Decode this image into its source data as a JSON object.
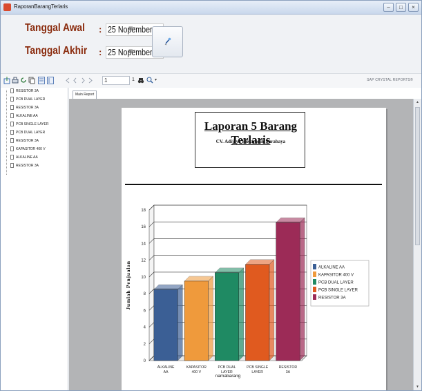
{
  "window": {
    "title": "RaporanBarangTerlaris"
  },
  "params": {
    "start_label": "Tanggal Awal",
    "start_value": "25 Nopember 2015",
    "end_label": "Tanggal Akhir",
    "end_value": "25 Nopember 2015",
    "colon": ":"
  },
  "toolbar": {
    "page_value": "1",
    "page_total": "1",
    "brand": "SAP CRYSTAL REPORTS®"
  },
  "tree": {
    "items": [
      "RESISTOR 3A",
      "PCB DUAL LAYER",
      "RESISTOR 3A",
      "ALKALINE AA",
      "PCB SINGLE LAYER",
      "PCB DUAL LAYER",
      "RESISTOR 3A",
      "KAPASITOR 400 V",
      "ALKALINE AA",
      "RESISTOR 3A"
    ]
  },
  "tabs": {
    "main": "Main Report"
  },
  "report": {
    "title": "Laporan 5 Barang Terlaris",
    "subtitle": "CV. Adijaya Elektronik Surabaya"
  },
  "chart_data": {
    "type": "bar",
    "categories": [
      "ALKALINE AA",
      "KAPASITOR 400 V",
      "PCB DUAL LAYER",
      "PCB SINGLE LAYER",
      "RESISTOR 3A"
    ],
    "values": [
      8.5,
      9.5,
      10.5,
      11.5,
      16.5
    ],
    "colors": [
      "#3b5f95",
      "#ef9a3c",
      "#1f8a63",
      "#e05a1f",
      "#9c2b57"
    ],
    "legend": [
      "ALKALINE AA",
      "KAPASITOR 400 V",
      "PCB DUAL LAYER",
      "PCB SINGLE LAYER",
      "RESISTOR 3A"
    ],
    "ylabel": "Jumlah Penjualan",
    "xlabel": "namabarang",
    "ylim": [
      0,
      18
    ],
    "yticks": [
      0,
      2,
      4,
      6,
      8,
      10,
      12,
      14,
      16,
      18
    ],
    "grid": true,
    "legend_position": "right"
  }
}
